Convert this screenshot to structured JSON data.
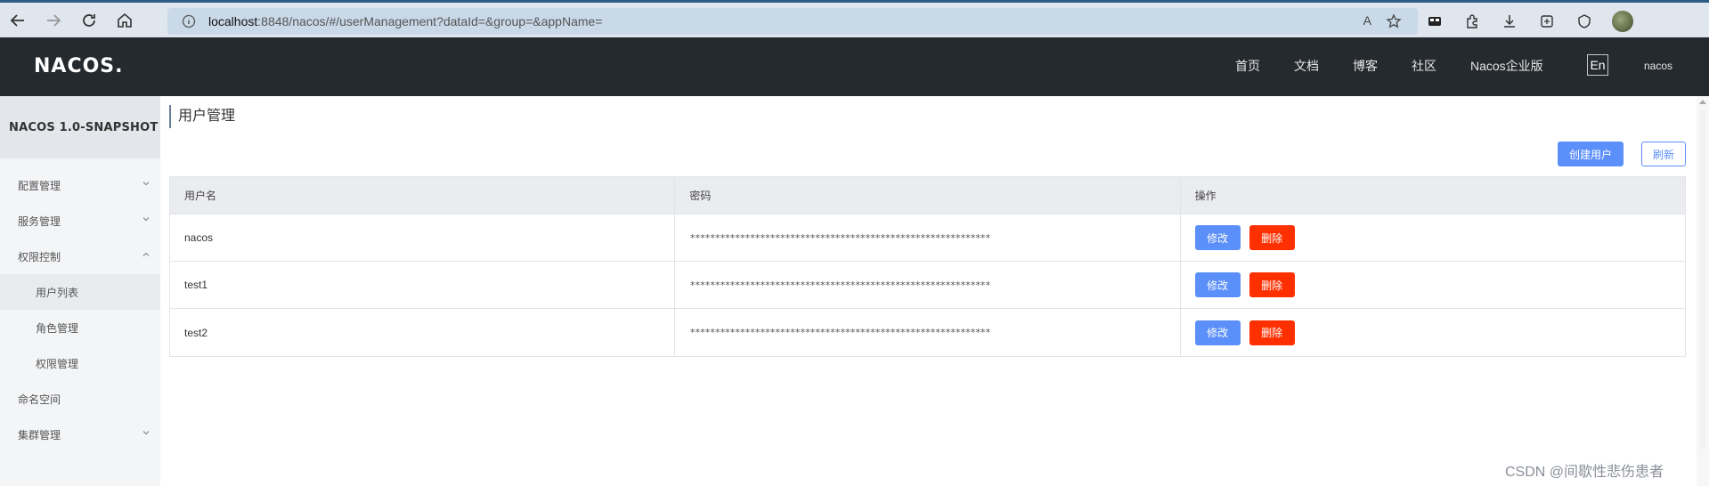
{
  "browser": {
    "url_host": "localhost",
    "url_path": ":8848/nacos/#/userManagement?dataId=&group=&appName=",
    "reader_label": "A",
    "icons": [
      "back-icon",
      "forward-icon",
      "refresh-icon",
      "home-icon",
      "info-icon",
      "read-aloud-icon",
      "favorite-icon",
      "collections-icon",
      "extensions-icon",
      "downloads-icon",
      "screenshot-icon",
      "browser-essentials-icon",
      "profile-avatar"
    ]
  },
  "header": {
    "logo": "NACOS.",
    "nav": [
      "首页",
      "文档",
      "博客",
      "社区",
      "Nacos企业版"
    ],
    "lang": "En",
    "user": "nacos"
  },
  "sidebar": {
    "version": "NACOS 1.0-SNAPSHOT",
    "items": [
      {
        "label": "配置管理",
        "expandable": true,
        "expanded": false
      },
      {
        "label": "服务管理",
        "expandable": true,
        "expanded": false
      },
      {
        "label": "权限控制",
        "expandable": true,
        "expanded": true
      },
      {
        "label": "用户列表",
        "sub": true,
        "active": true
      },
      {
        "label": "角色管理",
        "sub": true
      },
      {
        "label": "权限管理",
        "sub": true
      },
      {
        "label": "命名空间",
        "expandable": false
      },
      {
        "label": "集群管理",
        "expandable": true,
        "expanded": false
      }
    ]
  },
  "main": {
    "title": "用户管理",
    "create_button": "创建用户",
    "refresh_button": "刷新",
    "table": {
      "headers": [
        "用户名",
        "密码",
        "操作"
      ],
      "rows": [
        {
          "username": "nacos",
          "password": "************************************************************"
        },
        {
          "username": "test1",
          "password": "************************************************************"
        },
        {
          "username": "test2",
          "password": "************************************************************"
        }
      ],
      "edit_label": "修改",
      "delete_label": "删除"
    }
  },
  "watermark": "CSDN @间歇性悲伤患者",
  "colors": {
    "header_bg": "#252a2f",
    "primary": "#5b8ff9",
    "danger": "#ff3000",
    "sidebar_bg": "#f4f5f7"
  }
}
